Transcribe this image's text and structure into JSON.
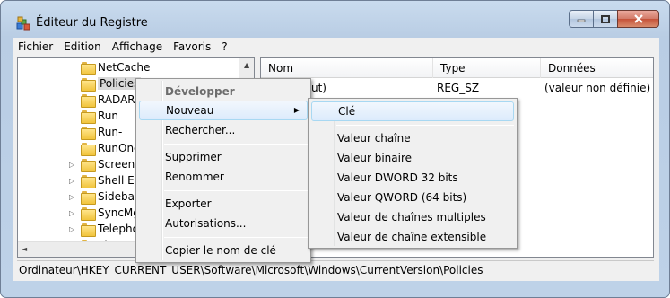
{
  "window": {
    "title": "Éditeur du Registre"
  },
  "menubar": [
    "Fichier",
    "Edition",
    "Affichage",
    "Favoris",
    "?"
  ],
  "tree": {
    "items": [
      {
        "label": "NetCache",
        "expandable": false
      },
      {
        "label": "Policies",
        "expandable": false,
        "selected": true
      },
      {
        "label": "RADAR",
        "expandable": false
      },
      {
        "label": "Run",
        "expandable": false
      },
      {
        "label": "Run-",
        "expandable": false
      },
      {
        "label": "RunOnc",
        "expandable": false
      },
      {
        "label": "Screens",
        "expandable": true
      },
      {
        "label": "Shell Ext",
        "expandable": true
      },
      {
        "label": "Sidebar",
        "expandable": true
      },
      {
        "label": "SyncMg",
        "expandable": true
      },
      {
        "label": "Telepho",
        "expandable": true
      },
      {
        "label": "Them",
        "expandable": true
      }
    ]
  },
  "list": {
    "columns": [
      "Nom",
      "Type",
      "Données"
    ],
    "rows": [
      {
        "name": "ut)",
        "type": "REG_SZ",
        "data": "(valeur non définie)"
      }
    ]
  },
  "status": "Ordinateur\\HKEY_CURRENT_USER\\Software\\Microsoft\\Windows\\CurrentVersion\\Policies",
  "context_menu": {
    "items": [
      "Développer",
      "Nouveau",
      "Rechercher...",
      "Supprimer",
      "Renommer",
      "Exporter",
      "Autorisations...",
      "Copier le nom de clé"
    ]
  },
  "submenu": {
    "items": [
      "Clé",
      "Valeur chaîne",
      "Valeur binaire",
      "Valeur DWORD 32 bits",
      "Valeur QWORD (64 bits)",
      "Valeur de chaînes multiples",
      "Valeur de chaîne extensible"
    ]
  }
}
